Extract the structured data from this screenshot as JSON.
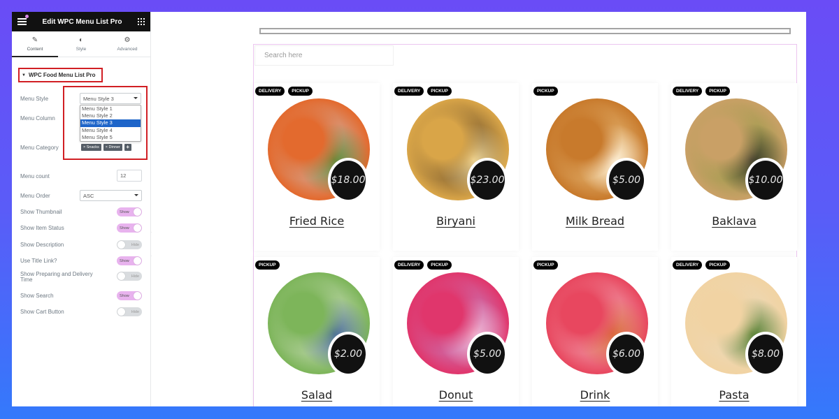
{
  "sidebar": {
    "title": "Edit WPC Menu List Pro",
    "tabs": [
      {
        "label": "Content",
        "icon": "pencil-icon",
        "glyph": "✎"
      },
      {
        "label": "Style",
        "icon": "contrast-icon",
        "glyph": "◐"
      },
      {
        "label": "Advanced",
        "icon": "gear-icon",
        "glyph": "⚙"
      }
    ],
    "section_title": "WPC Food Menu List Pro",
    "controls": {
      "menu_style": {
        "label": "Menu Style",
        "value": "Menu Style 3",
        "options": [
          "Menu Style 1",
          "Menu Style 2",
          "Menu Style 3",
          "Menu Style 4",
          "Menu Style 5"
        ],
        "selected_index": 2
      },
      "menu_column": {
        "label": "Menu Column"
      },
      "menu_category": {
        "label": "Menu Category",
        "tags": [
          "× Snacks",
          "× Dinner"
        ],
        "add": "+"
      },
      "menu_count": {
        "label": "Menu count",
        "value": "12"
      },
      "menu_order": {
        "label": "Menu Order",
        "value": "ASC"
      },
      "toggles": [
        {
          "label": "Show Thumbnail",
          "state": "Show",
          "on": true
        },
        {
          "label": "Show Item Status",
          "state": "Show",
          "on": true
        },
        {
          "label": "Show Description",
          "state": "Hide",
          "on": false
        },
        {
          "label": "Use Title Link?",
          "state": "Show",
          "on": true
        },
        {
          "label": "Show Preparing and Delivery Time",
          "state": "Hide",
          "on": false
        },
        {
          "label": "Show Search",
          "state": "Show",
          "on": true
        },
        {
          "label": "Show Cart Button",
          "state": "Hide",
          "on": false
        }
      ]
    },
    "collapse_glyph": "‹"
  },
  "preview": {
    "search_placeholder": "Search here",
    "items": [
      {
        "name": "Fried Rice",
        "price": "$18.00",
        "badges": [
          "DELIVERY",
          "PICKUP"
        ],
        "colors": [
          "#e36a2e",
          "#c9d4dc",
          "#5e8c3b"
        ]
      },
      {
        "name": "Biryani",
        "price": "$23.00",
        "badges": [
          "DELIVERY",
          "PICKUP"
        ],
        "colors": [
          "#d9a548",
          "#3b2a1e",
          "#f0d89a"
        ]
      },
      {
        "name": "Milk Bread",
        "price": "$5.00",
        "badges": [
          "PICKUP"
        ],
        "colors": [
          "#c87a2c",
          "#f4d79a",
          "#fff3dc"
        ]
      },
      {
        "name": "Baklava",
        "price": "$10.00",
        "badges": [
          "DELIVERY",
          "PICKUP"
        ],
        "colors": [
          "#c9a066",
          "#7d9a3a",
          "#3a3a2a"
        ]
      },
      {
        "name": "Salad",
        "price": "$2.00",
        "badges": [
          "PICKUP"
        ],
        "colors": [
          "#7db55a",
          "#f0efe8",
          "#4a6c9c"
        ]
      },
      {
        "name": "Donut",
        "price": "$5.00",
        "badges": [
          "DELIVERY",
          "PICKUP"
        ],
        "colors": [
          "#e0366c",
          "#b9a3e6",
          "#f2b6d2"
        ]
      },
      {
        "name": "Drink",
        "price": "$6.00",
        "badges": [
          "PICKUP"
        ],
        "colors": [
          "#e8475f",
          "#f6d2d8",
          "#d96d3a"
        ]
      },
      {
        "name": "Pasta",
        "price": "$8.00",
        "badges": [
          "DELIVERY",
          "PICKUP"
        ],
        "colors": [
          "#f1d3a3",
          "#e9dcc4",
          "#4f7d2f"
        ]
      }
    ]
  }
}
